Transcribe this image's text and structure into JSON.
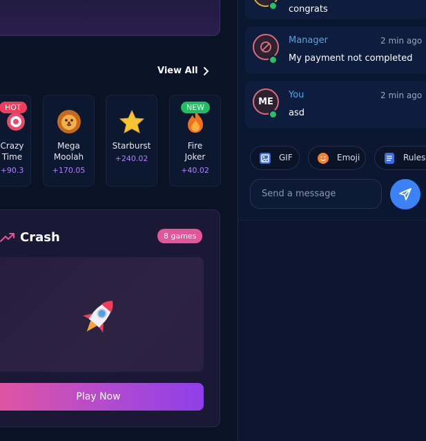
{
  "games": {
    "view_all_label": "View All",
    "cards": [
      {
        "name_line1": "Crazy",
        "name_line2": "Time",
        "amount": "+90.3",
        "tag": "HOT",
        "icon": "target-icon"
      },
      {
        "name_line1": "Mega",
        "name_line2": "Moolah",
        "amount": "+170.05",
        "tag": "",
        "icon": "lion-icon"
      },
      {
        "name_line1": "Starburst",
        "name_line2": "",
        "amount": "+240.02",
        "tag": "",
        "icon": "star-icon"
      },
      {
        "name_line1": "Fire",
        "name_line2": "Joker",
        "amount": "+40.02",
        "tag": "NEW",
        "icon": "fire-icon"
      }
    ]
  },
  "crash": {
    "title": "Crash",
    "badge": "8 games",
    "play_label": "Play Now"
  },
  "chat": {
    "messages": [
      {
        "user": "",
        "time": "",
        "text": "congrats"
      },
      {
        "user": "Manager",
        "time": "2 min ago",
        "text": "My payment not completed"
      },
      {
        "user": "You",
        "time": "2 min ago",
        "text": "asd",
        "avatar_text": "ME"
      }
    ],
    "chips": [
      "GIF",
      "Emoji",
      "Rules"
    ],
    "input_placeholder": "Send a message"
  },
  "colors": {
    "accent": "#3b82f6",
    "badge": "#e3569a",
    "online": "#22c55e",
    "hot": "#ef3d5a",
    "new": "#1fbf61"
  }
}
